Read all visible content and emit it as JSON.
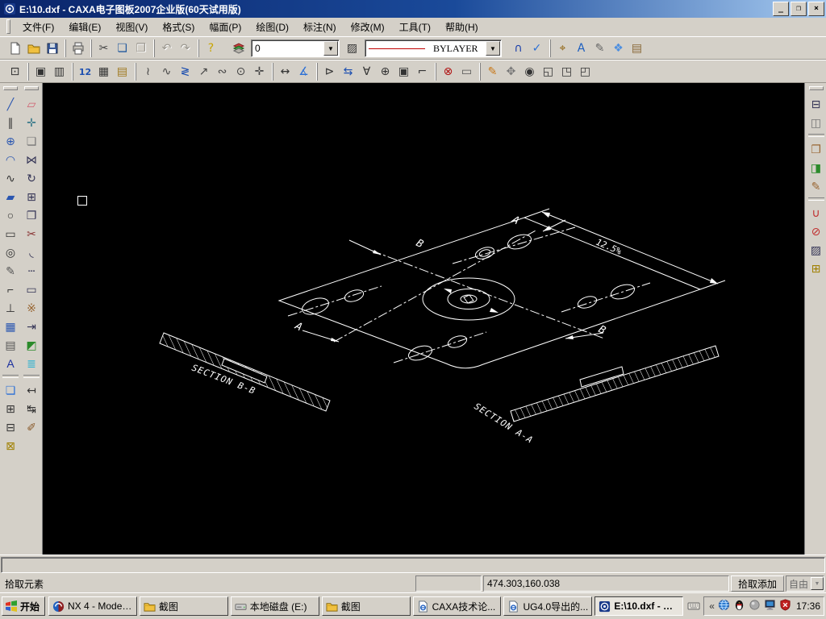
{
  "window": {
    "title": "E:\\10.dxf - CAXA电子图板2007企业版(60天试用版)",
    "buttons": {
      "minimize": "_",
      "restore": "❐",
      "close": "×"
    }
  },
  "menu": {
    "items": [
      {
        "key": "file",
        "label": "文件(F)"
      },
      {
        "key": "edit",
        "label": "编辑(E)"
      },
      {
        "key": "view",
        "label": "视图(V)"
      },
      {
        "key": "format",
        "label": "格式(S)"
      },
      {
        "key": "paper",
        "label": "幅面(P)"
      },
      {
        "key": "draw",
        "label": "绘图(D)"
      },
      {
        "key": "dimension",
        "label": "标注(N)"
      },
      {
        "key": "modify",
        "label": "修改(M)"
      },
      {
        "key": "tools",
        "label": "工具(T)"
      },
      {
        "key": "help",
        "label": "帮助(H)"
      }
    ]
  },
  "toolbar1": {
    "groups": [
      [
        {
          "n": "new",
          "ic": "doc"
        },
        {
          "n": "open",
          "ic": "folder"
        },
        {
          "n": "save",
          "ic": "disk"
        }
      ],
      [
        {
          "n": "print",
          "ic": "printer"
        }
      ],
      [
        {
          "n": "cut",
          "g": "✂",
          "c": "#444444"
        },
        {
          "n": "copy",
          "g": "❏",
          "c": "#235a9e"
        },
        {
          "n": "paste",
          "g": "❐",
          "c": "#9a968e",
          "d": 1
        }
      ],
      [
        {
          "n": "undo",
          "g": "↶",
          "c": "#9a968e",
          "d": 1
        },
        {
          "n": "redo",
          "g": "↷",
          "c": "#9a968e",
          "d": 1
        }
      ],
      [
        {
          "n": "help",
          "g": "?",
          "c": "#c8a400"
        }
      ]
    ],
    "layer_manager": {
      "n": "layer-manager",
      "ic": "layers"
    },
    "layer_combo": {
      "value": "0"
    },
    "layer_state": {
      "n": "layer-state",
      "g": "▨",
      "c": "#333333"
    },
    "linetype_combo": {
      "value": "BYLAYER",
      "line_color": "#c00000"
    },
    "right_groups": [
      [
        {
          "n": "snap-nearest",
          "g": "∩",
          "c": "#1b3faa"
        },
        {
          "n": "snap-point",
          "g": "✓",
          "c": "#2a6fd6"
        }
      ],
      [
        {
          "n": "dynamic-pan",
          "g": "⌖",
          "c": "#8a5a00"
        },
        {
          "n": "find-text",
          "g": "A",
          "c": "#1d5fc0"
        },
        {
          "n": "view-edit",
          "g": "✎",
          "c": "#666666"
        },
        {
          "n": "regen-view",
          "g": "❖",
          "c": "#4d8fe0"
        },
        {
          "n": "print-preview",
          "g": "▤",
          "c": "#8a6a3a"
        }
      ]
    ]
  },
  "toolbar2": {
    "groups": [
      [
        {
          "n": "zoom-extents",
          "g": "⊡",
          "c": "#333333"
        }
      ],
      [
        {
          "n": "window-frame",
          "g": "▣",
          "c": "#333333"
        },
        {
          "n": "text-frame",
          "g": "▥",
          "c": "#333333"
        }
      ],
      [
        {
          "n": "edit-sequence",
          "g": "12",
          "c": "#1d4fb0",
          "small": 1
        },
        {
          "n": "table-text",
          "g": "▦",
          "c": "#333333"
        },
        {
          "n": "sheet-edit",
          "g": "▤",
          "c": "#a07a20"
        }
      ],
      [
        {
          "n": "polyline-edit",
          "g": "≀",
          "c": "#444444"
        },
        {
          "n": "wave-line",
          "g": "∿",
          "c": "#444444"
        },
        {
          "n": "zigzag-line",
          "g": "≷",
          "c": "#1d4fb0"
        },
        {
          "n": "arrow-line",
          "g": "↗",
          "c": "#444444"
        },
        {
          "n": "contour-fill",
          "g": "∾",
          "c": "#444444"
        },
        {
          "n": "center-hole",
          "g": "⊙",
          "c": "#444444"
        },
        {
          "n": "cross-point",
          "g": "✛",
          "c": "#444444"
        }
      ],
      [
        {
          "n": "dim-linear",
          "g": "↔",
          "c": "#333333"
        },
        {
          "n": "dim-angular",
          "g": "∡",
          "c": "#2a6fd6"
        }
      ],
      [
        {
          "n": "dim-leader",
          "g": "⊳",
          "c": "#333333"
        },
        {
          "n": "dim-datum",
          "g": "⇆",
          "c": "#1d4fb0"
        },
        {
          "n": "dim-tolerance",
          "g": "∀",
          "c": "#333333"
        },
        {
          "n": "dim-circle",
          "g": "⊕",
          "c": "#333333"
        },
        {
          "n": "dim-frame",
          "g": "▣",
          "c": "#333333"
        },
        {
          "n": "dim-step",
          "g": "⌐",
          "c": "#333333"
        }
      ],
      [
        {
          "n": "check-drawing",
          "g": "⊗",
          "c": "#b01010"
        },
        {
          "n": "ruler-measure",
          "g": "▭",
          "c": "#555555"
        }
      ],
      [
        {
          "n": "sketch-pencil",
          "g": "✎",
          "c": "#c87818"
        },
        {
          "n": "pan-hand",
          "g": "✥",
          "c": "#777777"
        },
        {
          "n": "zoom-dynamic",
          "g": "◉",
          "c": "#333333"
        },
        {
          "n": "zoom-window",
          "g": "◱",
          "c": "#333333"
        },
        {
          "n": "zoom-all",
          "g": "◳",
          "c": "#333333"
        },
        {
          "n": "zoom-previous",
          "g": "◰",
          "c": "#333333"
        }
      ]
    ]
  },
  "left_toolbar": {
    "col1": [
      {
        "n": "line",
        "g": "╱",
        "c": "#2a56b0"
      },
      {
        "n": "parallel-line",
        "g": "∥",
        "c": "#333333"
      },
      {
        "n": "circle",
        "g": "⊕",
        "c": "#2a56b0"
      },
      {
        "n": "arc",
        "g": "◠",
        "c": "#2a56b0"
      },
      {
        "n": "spline",
        "g": "∿",
        "c": "#333333"
      },
      {
        "n": "solid-fill",
        "g": "▰",
        "c": "#2a56b0"
      },
      {
        "n": "ellipse",
        "g": "○",
        "c": "#333333"
      },
      {
        "n": "rectangle",
        "g": "▭",
        "c": "#333333"
      },
      {
        "n": "polygon",
        "g": "◎",
        "c": "#333333"
      },
      {
        "n": "hatch-pen",
        "g": "✎",
        "c": "#555555"
      },
      {
        "n": "chamfer",
        "g": "⌐",
        "c": "#333333"
      },
      {
        "n": "axis-line",
        "g": "⊥",
        "c": "#333333"
      },
      {
        "n": "grid-hatch",
        "g": "▦",
        "c": "#2a56b0"
      },
      {
        "n": "profile-stamp",
        "g": "▤",
        "c": "#555555"
      },
      {
        "n": "text",
        "g": "A",
        "c": "#1b2f9e"
      },
      {
        "sep": 1
      },
      {
        "n": "block-create",
        "g": "❏",
        "c": "#2a6fd6"
      },
      {
        "n": "label-tag-1",
        "g": "⊞",
        "c": "#333333"
      },
      {
        "n": "label-tag-2",
        "g": "⊟",
        "c": "#333333"
      },
      {
        "n": "label-tag-3",
        "g": "⊠",
        "c": "#a08000"
      }
    ],
    "col2": [
      {
        "n": "erase",
        "g": "▱",
        "c": "#d06070"
      },
      {
        "n": "move",
        "g": "✛",
        "c": "#3a7a8a"
      },
      {
        "n": "copy-object",
        "g": "❏",
        "c": "#777777"
      },
      {
        "n": "mirror",
        "g": "⋈",
        "c": "#333355"
      },
      {
        "n": "rotate",
        "g": "↻",
        "c": "#333355"
      },
      {
        "n": "array",
        "g": "⊞",
        "c": "#333355"
      },
      {
        "n": "offset",
        "g": "❐",
        "c": "#333355"
      },
      {
        "n": "trim-scissors",
        "g": "✂",
        "c": "#883333"
      },
      {
        "n": "fillet",
        "g": "◟",
        "c": "#333355"
      },
      {
        "n": "break-line",
        "g": "┄",
        "c": "#333355"
      },
      {
        "n": "stretch-box",
        "g": "▭",
        "c": "#333355"
      },
      {
        "n": "explode",
        "g": "※",
        "c": "#996633"
      },
      {
        "n": "extend",
        "g": "⇥",
        "c": "#333355"
      },
      {
        "n": "block-edit",
        "g": "◩",
        "c": "#2a8a2a"
      },
      {
        "n": "layer-move",
        "g": "≣",
        "c": "#2ab0d0"
      },
      {
        "sep": 1
      },
      {
        "n": "dim-edit",
        "g": "↤",
        "c": "#333333"
      },
      {
        "n": "dim-drive",
        "g": "↹",
        "c": "#333333"
      },
      {
        "n": "format-brush",
        "g": "✐",
        "c": "#8a5a2a"
      }
    ]
  },
  "right_toolbar": {
    "items": [
      {
        "n": "block-hide",
        "g": "⊟",
        "c": "#333355"
      },
      {
        "n": "solid-3d",
        "g": "◫",
        "c": "#777777"
      },
      {
        "sep": 1
      },
      {
        "n": "block-insert",
        "g": "❐",
        "c": "#996633"
      },
      {
        "n": "block-attribute",
        "g": "◨",
        "c": "#2a8a2a"
      },
      {
        "n": "block-modify",
        "g": "✎",
        "c": "#996633"
      },
      {
        "sep": 1
      },
      {
        "n": "weld-symbol",
        "g": "∪",
        "c": "#c03030"
      },
      {
        "n": "hole-symbol",
        "g": "⊘",
        "c": "#c03030"
      },
      {
        "n": "section-hatch",
        "g": "▨",
        "c": "#333355"
      },
      {
        "n": "block-new",
        "g": "⊞",
        "c": "#a08000"
      }
    ]
  },
  "drawing": {
    "labels": {
      "b_top": "B",
      "a_top": "A",
      "a_bottom": "A",
      "b_bottom": "B",
      "dim": "12.5%",
      "section_bb": "SECTION  B-B",
      "section_aa": "SECTION  A-A"
    }
  },
  "command_bar": {
    "value": ""
  },
  "status_bar": {
    "message": "拾取元素",
    "panel2": "",
    "coords": "474.303,160.038",
    "pick_mode": "拾取添加",
    "select_mode": "自由"
  },
  "taskbar": {
    "start_label": "开始",
    "buttons": [
      {
        "key": "nx",
        "label": "NX 4 - Modelin...",
        "ic": "nx"
      },
      {
        "key": "screenshot-1",
        "label": "截图",
        "ic": "folder"
      },
      {
        "key": "local-disk-e",
        "label": "本地磁盘 (E:)",
        "ic": "drive"
      },
      {
        "key": "screenshot-2",
        "label": "截图",
        "ic": "folder"
      },
      {
        "key": "caxa-forum",
        "label": "CAXA技术论...",
        "ic": "iepage"
      },
      {
        "key": "ug-export",
        "label": "UG4.0导出的...",
        "ic": "iepage"
      },
      {
        "key": "caxa-dxf",
        "label": "E:\\10.dxf - CA...",
        "ic": "caxa",
        "active": true
      }
    ],
    "tray": {
      "chevrons": "«",
      "time": "17:36",
      "icons": [
        {
          "n": "network-globe",
          "ic": "globe"
        },
        {
          "n": "qq-messenger",
          "ic": "penguin"
        },
        {
          "n": "volume",
          "ic": "sphere"
        },
        {
          "n": "display-settings",
          "ic": "monitor"
        },
        {
          "n": "antivirus-shield",
          "ic": "shield"
        }
      ]
    }
  }
}
